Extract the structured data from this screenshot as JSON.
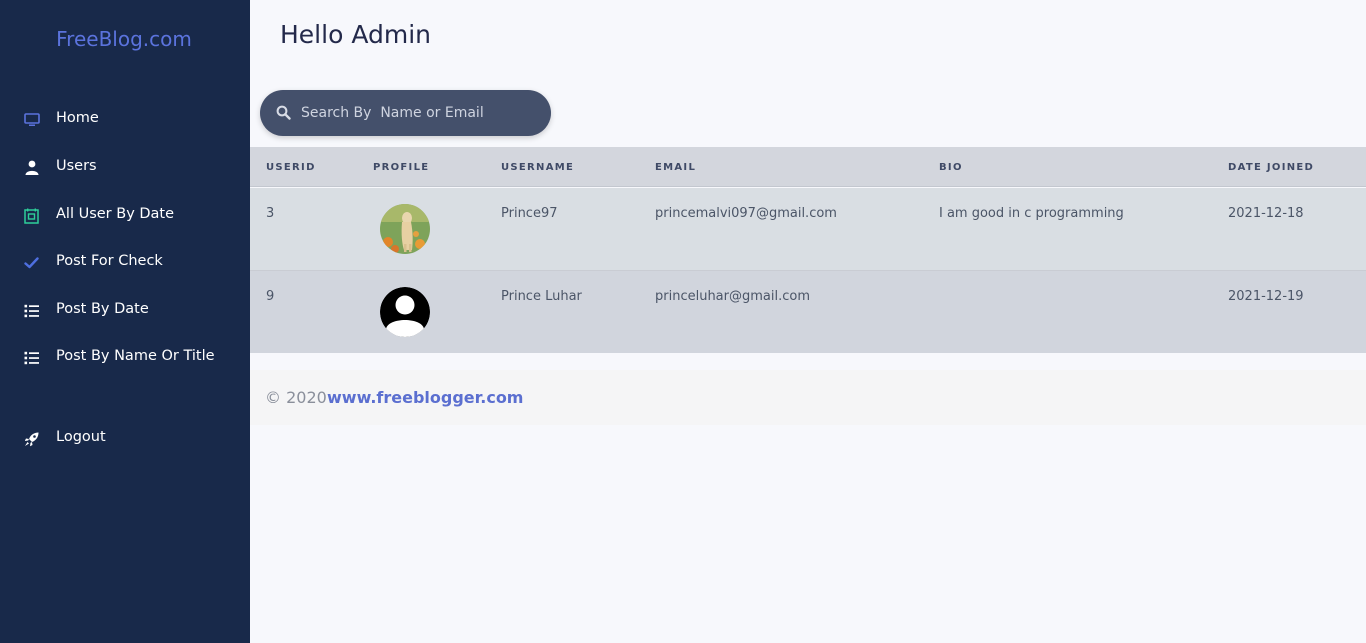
{
  "sidebar": {
    "brand": "FreeBlog.com",
    "items": [
      {
        "label": "Home",
        "icon": "monitor-icon"
      },
      {
        "label": "Users",
        "icon": "user-icon"
      },
      {
        "label": "All User By Date",
        "icon": "calendar-icon"
      },
      {
        "label": "Post For Check",
        "icon": "check-icon"
      },
      {
        "label": "Post By Date",
        "icon": "list-icon"
      },
      {
        "label": "Post By Name Or Title",
        "icon": "list-icon"
      }
    ],
    "logout": {
      "label": "Logout",
      "icon": "rocket-icon"
    }
  },
  "header": {
    "greeting": "Hello Admin"
  },
  "search": {
    "placeholder": "Search By  Name or Email"
  },
  "table": {
    "columns": [
      "USERID",
      "PROFILE",
      "USERNAME",
      "EMAIL",
      "BIO",
      "DATE JOINED"
    ],
    "rows": [
      {
        "userid": "3",
        "profile": "photo-avatar",
        "username": "Prince97",
        "email": "princemalvi097@gmail.com",
        "bio": "I am good in c programming",
        "date_joined": "2021-12-18"
      },
      {
        "userid": "9",
        "profile": "default-avatar",
        "username": "Prince Luhar",
        "email": "princeluhar@gmail.com",
        "bio": "",
        "date_joined": "2021-12-19"
      }
    ]
  },
  "footer": {
    "copyright": "© 2020",
    "link": "www.freeblogger.com"
  },
  "colors": {
    "sidebar_bg": "#18294a",
    "brand": "#5b73dd",
    "accent_check": "#4e6fe0",
    "accent_calendar": "#2ecf9a",
    "search_bg": "#44506b"
  }
}
